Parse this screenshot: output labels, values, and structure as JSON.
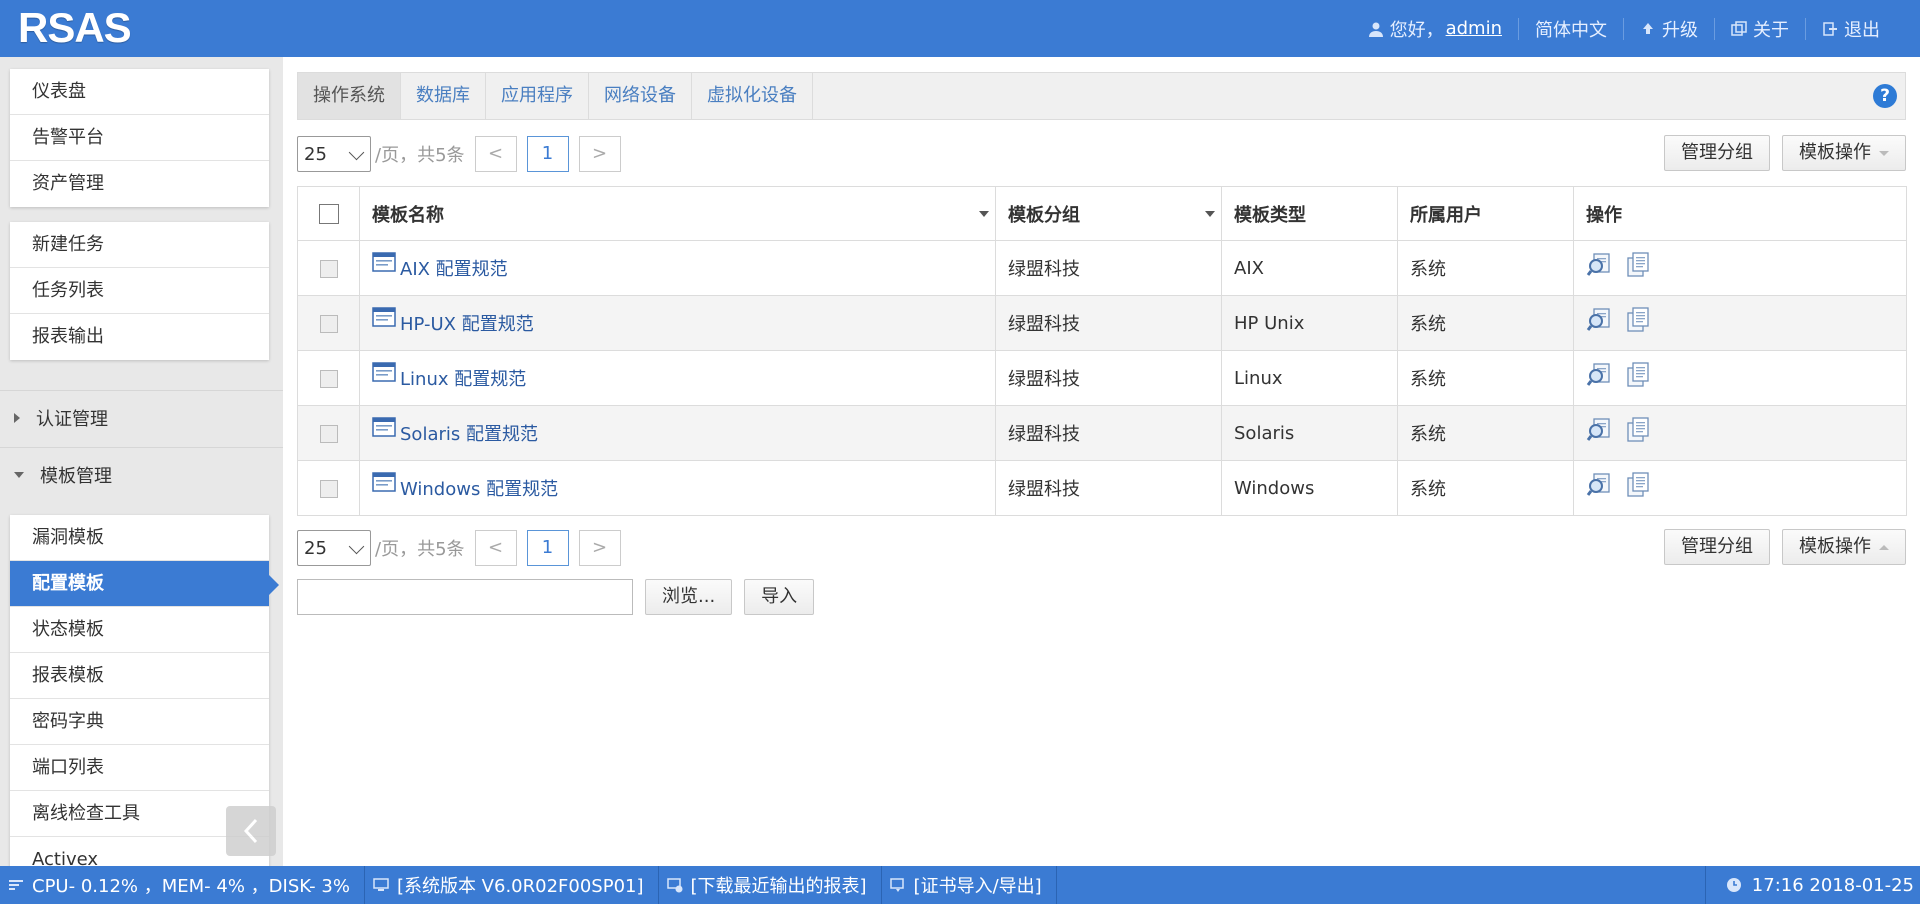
{
  "header": {
    "logo": "RSAS",
    "greeting": "您好，",
    "username": "admin",
    "language": "简体中文",
    "upgrade": "升级",
    "about": "关于",
    "logout": "退出"
  },
  "sidebar": {
    "group1": [
      "仪表盘",
      "告警平台",
      "资产管理"
    ],
    "group2": [
      "新建任务",
      "任务列表",
      "报表输出"
    ],
    "section_auth": "认证管理",
    "section_template": "模板管理",
    "template_items": [
      "漏洞模板",
      "配置模板",
      "状态模板",
      "报表模板",
      "密码字典",
      "端口列表",
      "离线检查工具",
      "Activex"
    ]
  },
  "tabs": [
    "操作系统",
    "数据库",
    "应用程序",
    "网络设备",
    "虚拟化设备"
  ],
  "pager": {
    "page_size": "25",
    "summary": "/页，共5条",
    "prev": "<",
    "current": "1",
    "next": ">"
  },
  "buttons": {
    "manage_group": "管理分组",
    "template_ops": "模板操作",
    "browse": "浏览...",
    "import": "导入"
  },
  "table": {
    "headers": [
      "模板名称",
      "模板分组",
      "模板类型",
      "所属用户",
      "操作"
    ],
    "rows": [
      {
        "name": "AIX 配置规范",
        "group": "绿盟科技",
        "type": "AIX",
        "user": "系统"
      },
      {
        "name": "HP-UX 配置规范",
        "group": "绿盟科技",
        "type": "HP Unix",
        "user": "系统"
      },
      {
        "name": "Linux 配置规范",
        "group": "绿盟科技",
        "type": "Linux",
        "user": "系统"
      },
      {
        "name": "Solaris 配置规范",
        "group": "绿盟科技",
        "type": "Solaris",
        "user": "系统"
      },
      {
        "name": "Windows 配置规范",
        "group": "绿盟科技",
        "type": "Windows",
        "user": "系统"
      }
    ]
  },
  "statusbar": {
    "resources": "CPU-  0.12% ，MEM-  4% ，DISK-  3%",
    "version": "[系统版本 V6.0R02F00SP01]",
    "download": "[下载最近输出的报表]",
    "certificate": "[证书导入/导出]",
    "datetime": "17:16 2018-01-25"
  },
  "icons": {
    "user": "user-icon",
    "upgrade": "upload-arrow-icon",
    "about": "about-icon",
    "logout": "logout-icon",
    "help": "help-icon",
    "template_doc": "document-icon",
    "view": "magnifier-icon",
    "copy": "copy-icon",
    "clock": "clock-icon"
  },
  "colors": {
    "header_bg": "#3b7bd3",
    "link": "#2b5aa1",
    "active_menu": "#3b7bd3"
  }
}
